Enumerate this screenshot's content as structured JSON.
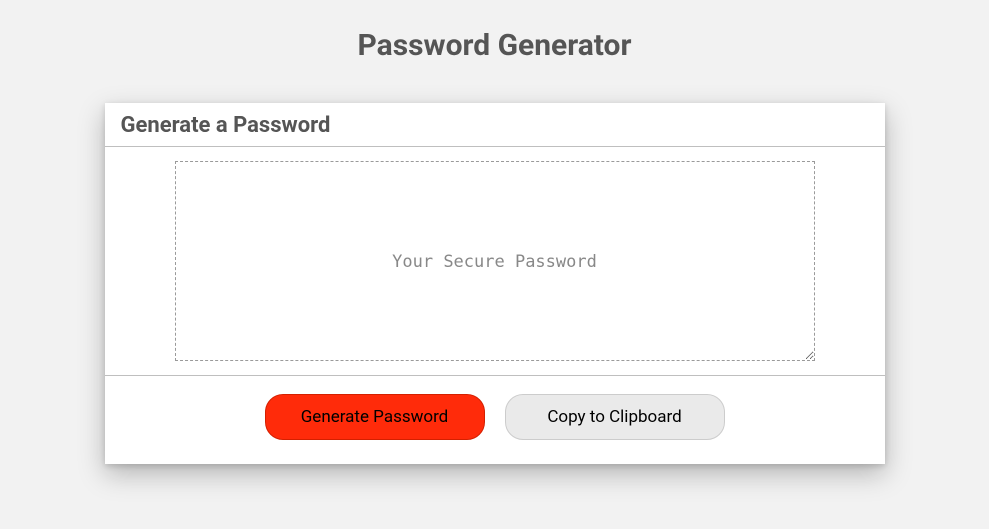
{
  "header": {
    "title": "Password Generator"
  },
  "card": {
    "heading": "Generate a Password",
    "passwordPlaceholder": "Your Secure Password",
    "passwordValue": ""
  },
  "buttons": {
    "generate": "Generate Password",
    "copy": "Copy to Clipboard"
  },
  "colors": {
    "accent": "#ff2b0a",
    "pageBg": "#f2f2f2",
    "textMuted": "#555"
  }
}
